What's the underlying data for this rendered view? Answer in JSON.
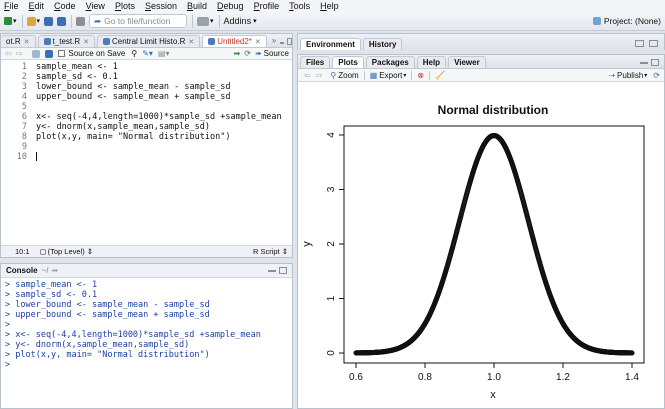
{
  "menubar": {
    "items": [
      "File",
      "Edit",
      "Code",
      "View",
      "Plots",
      "Session",
      "Build",
      "Debug",
      "Profile",
      "Tools",
      "Help"
    ]
  },
  "toolbar": {
    "goto_placeholder": "Go to file/function",
    "addins_label": "Addins",
    "project_label": "Project: (None)"
  },
  "editor": {
    "tabs": [
      {
        "label": "ot.R",
        "active": false
      },
      {
        "label": "t_test.R",
        "active": false
      },
      {
        "label": "Central Limit Histo.R",
        "active": false
      },
      {
        "label": "Untitled2*",
        "active": true
      }
    ],
    "source_on_save_label": "Source on Save",
    "source_label": "Source",
    "lines": [
      {
        "n": "1",
        "text": "sample_mean <- 1"
      },
      {
        "n": "2",
        "text": "sample_sd <- 0.1"
      },
      {
        "n": "3",
        "text": "lower_bound <- sample_mean - sample_sd"
      },
      {
        "n": "4",
        "text": "upper_bound <- sample_mean + sample_sd"
      },
      {
        "n": "5",
        "text": ""
      },
      {
        "n": "6",
        "text": "x<- seq(-4,4,length=1000)*sample_sd +sample_mean"
      },
      {
        "n": "7",
        "text": "y<- dnorm(x,sample_mean,sample_sd)"
      },
      {
        "n": "8",
        "text": "plot(x,y, main= \"Normal distribution\")"
      },
      {
        "n": "9",
        "text": ""
      },
      {
        "n": "10",
        "text": ""
      }
    ],
    "status_position": "10:1",
    "status_scope": "(Top Level)",
    "status_type": "R Script"
  },
  "console": {
    "title": "Console",
    "path": "~/",
    "lines": [
      "> sample_mean <- 1",
      "> sample_sd <- 0.1",
      "> lower_bound <- sample_mean - sample_sd",
      "> upper_bound <- sample_mean + sample_sd",
      ">",
      "> x<- seq(-4,4,length=1000)*sample_sd +sample_mean",
      "> y<- dnorm(x,sample_mean,sample_sd)",
      "> plot(x,y, main= \"Normal distribution\")",
      "> "
    ]
  },
  "env": {
    "tabs": [
      "Environment",
      "History"
    ]
  },
  "plots": {
    "tabs": [
      "Files",
      "Plots",
      "Packages",
      "Help",
      "Viewer"
    ],
    "zoom_label": "Zoom",
    "export_label": "Export",
    "publish_label": "Publish"
  },
  "chart_data": {
    "type": "scatter",
    "title": "Normal distribution",
    "xlabel": "x",
    "ylabel": "y",
    "xlim": [
      0.6,
      1.4
    ],
    "ylim": [
      0,
      4
    ],
    "xticks": [
      "0.6",
      "0.8",
      "1.0",
      "1.2",
      "1.4"
    ],
    "yticks": [
      "0",
      "1",
      "2",
      "3",
      "4"
    ],
    "series": [
      {
        "distribution": "normal",
        "mean": 1,
        "sd": 0.1,
        "x_from": 0.6,
        "x_to": 1.4,
        "n_points": 1000
      }
    ]
  }
}
